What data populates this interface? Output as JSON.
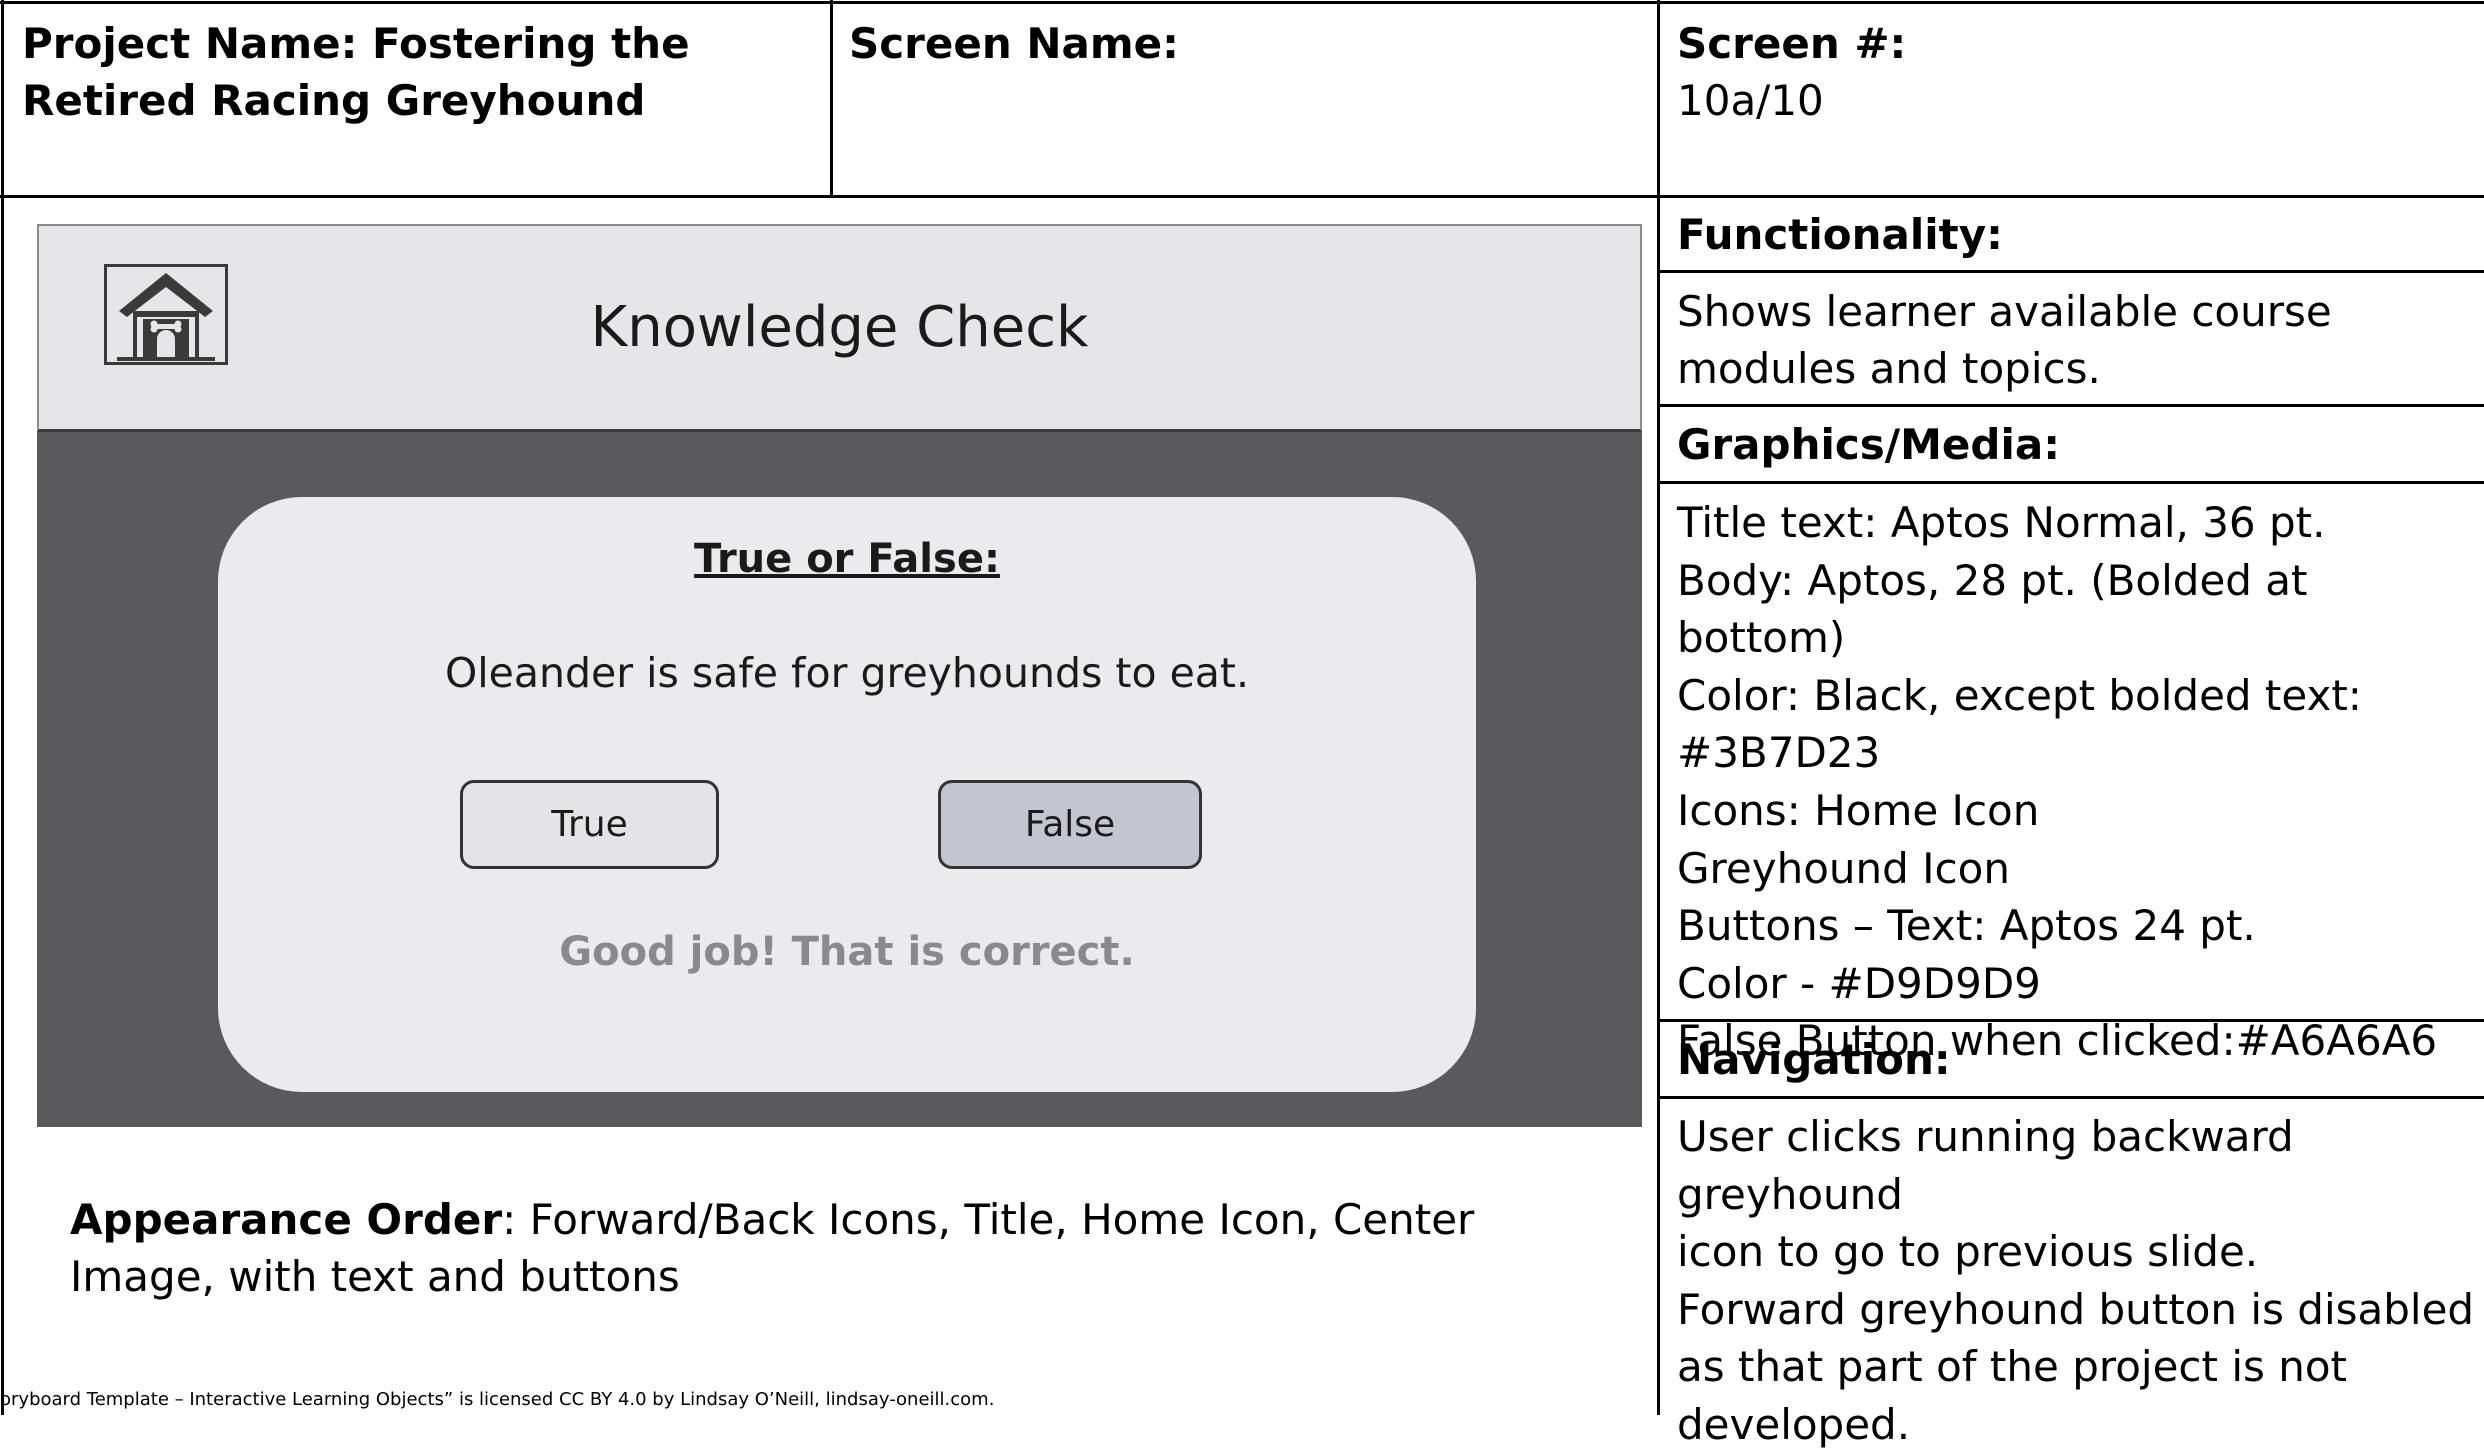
{
  "header": {
    "project_label": "Project Name: Fostering the Retired Racing Greyhound",
    "screen_name_label": "Screen Name:",
    "screen_number_label": "Screen #:",
    "screen_number_value": "10a/10"
  },
  "slide": {
    "home_icon": "home-icon",
    "title": "Knowledge Check",
    "card_title": "True or False:",
    "question": "Oleander is safe for greyhounds to eat.",
    "true_button": "True",
    "false_button": "False",
    "feedback": "Good job! That is correct."
  },
  "appearance": {
    "label": "Appearance Order",
    "text": ": Forward/Back Icons, Title, Home Icon, Center Image, with text and buttons"
  },
  "functionality": {
    "label": "Functionality:",
    "text": "Shows learner available course modules and topics."
  },
  "graphics": {
    "label": "Graphics/Media:",
    "lines": [
      "Title text: Aptos Normal, 36 pt.",
      "Body: Aptos, 28 pt. (Bolded at bottom)",
      "Color: Black, except bolded text:",
      "#3B7D23",
      "Icons: Home Icon",
      "Greyhound Icon",
      "Buttons – Text: Aptos 24 pt.",
      "Color - #D9D9D9",
      "False Button when clicked:#A6A6A6"
    ]
  },
  "navigation": {
    "label": "Navigation:",
    "lines": [
      "User clicks running backward greyhound",
      "icon to go to previous slide.",
      "Forward greyhound button is disabled",
      "as that part of the project is not",
      "developed."
    ]
  },
  "footer": {
    "license": "oryboard Template – Interactive Learning Objects” is licensed CC BY 4.0 by Lindsay O’Neill, lindsay-oneill.com."
  },
  "colors": {
    "slide_header_bg": "#e6e6e9",
    "slide_body_bg": "#5a5a5c",
    "card_bg": "#ebebed",
    "false_button_bg": "#c4c5d0",
    "feedback_text": "#8a8a8e"
  }
}
